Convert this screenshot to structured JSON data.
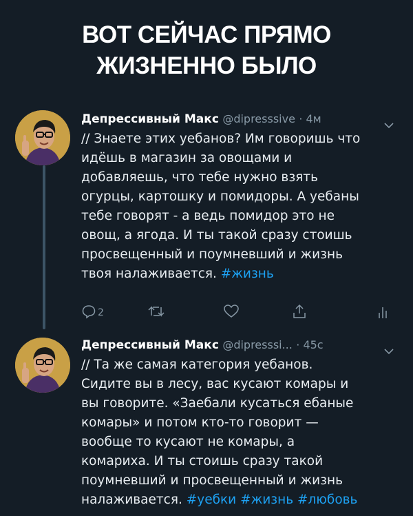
{
  "headline": {
    "line1": "ВОТ СЕЙЧАС ПРЯМО",
    "line2": "ЖИЗНЕННО БЫЛО"
  },
  "colors": {
    "background": "#141d26",
    "text": "#e8edf1",
    "muted": "#8899a6",
    "hashtag": "#1da1f2",
    "thread_line": "#3d5466"
  },
  "tweets": [
    {
      "name": "Депрессивный Макс",
      "handle": "@dipresssive",
      "time": "· 4м",
      "lines": [
        "// Знаете этих уебанов? Им говоришь что",
        "идёшь в магазин за овощами и",
        "добавляешь, что тебе нужно взять",
        "огурцы, картошку и помидоры. А уебаны",
        "тебе говорят - а ведь помидор это не",
        "овощ, а ягода. И ты такой сразу стоишь",
        "просвещенный и поумневший и жизнь",
        "твоя налаживается."
      ],
      "hashtags": [
        "#жизнь"
      ],
      "actions": {
        "reply_icon": "reply-icon",
        "reply_count": "2",
        "retweet_icon": "retweet-icon",
        "like_icon": "heart-icon",
        "share_icon": "share-icon",
        "analytics_icon": "analytics-icon"
      }
    },
    {
      "name": "Депрессивный Макс",
      "handle": "@dipresssi...",
      "time": "· 45с",
      "lines": [
        "// Та же самая категория уебанов.",
        "Сидите вы в лесу, вас кусают комары и",
        "вы говорите. «Заебали кусаться ебаные",
        "комары» и потом кто-то говорит —",
        "вообще то кусают не комары, а",
        "комариха. И ты стоишь сразу такой",
        "поумневший и просвещенный и жизнь",
        "налаживается."
      ],
      "hashtags": [
        "#уебки",
        "#жизнь",
        "#любовь"
      ]
    }
  ]
}
